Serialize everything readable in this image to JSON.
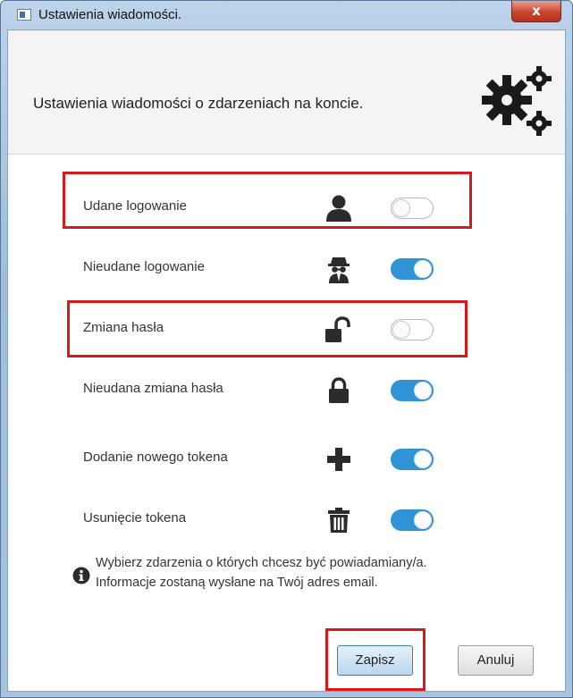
{
  "window": {
    "title": "Ustawienia wiadomości.",
    "close_label": "x"
  },
  "header": {
    "text": "Ustawienia wiadomości o zdarzeniach na koncie.",
    "icon": "gears-icon"
  },
  "settings": [
    {
      "label": "Udane logowanie",
      "icon": "user-icon",
      "enabled": false,
      "highlighted": true
    },
    {
      "label": "Nieudane logowanie",
      "icon": "spy-icon",
      "enabled": true,
      "highlighted": false
    },
    {
      "label": "Zmiana hasła",
      "icon": "unlock-icon",
      "enabled": false,
      "highlighted": true
    },
    {
      "label": "Nieudana zmiana hasła",
      "icon": "lock-icon",
      "enabled": true,
      "highlighted": false
    },
    {
      "label": "Dodanie nowego tokena",
      "icon": "plus-icon",
      "enabled": true,
      "highlighted": false
    },
    {
      "label": "Usunięcie tokena",
      "icon": "trash-icon",
      "enabled": true,
      "highlighted": false
    }
  ],
  "info": {
    "icon": "info-icon",
    "line1": "Wybierz zdarzenia o których chcesz być powiadamiany/a.",
    "line2": "Informacje zostaną wysłane na Twój adres email."
  },
  "buttons": {
    "save_label": "Zapisz",
    "cancel_label": "Anuluj"
  },
  "colors": {
    "toggle_on": "#2f93d6",
    "highlight": "#d7191d"
  }
}
